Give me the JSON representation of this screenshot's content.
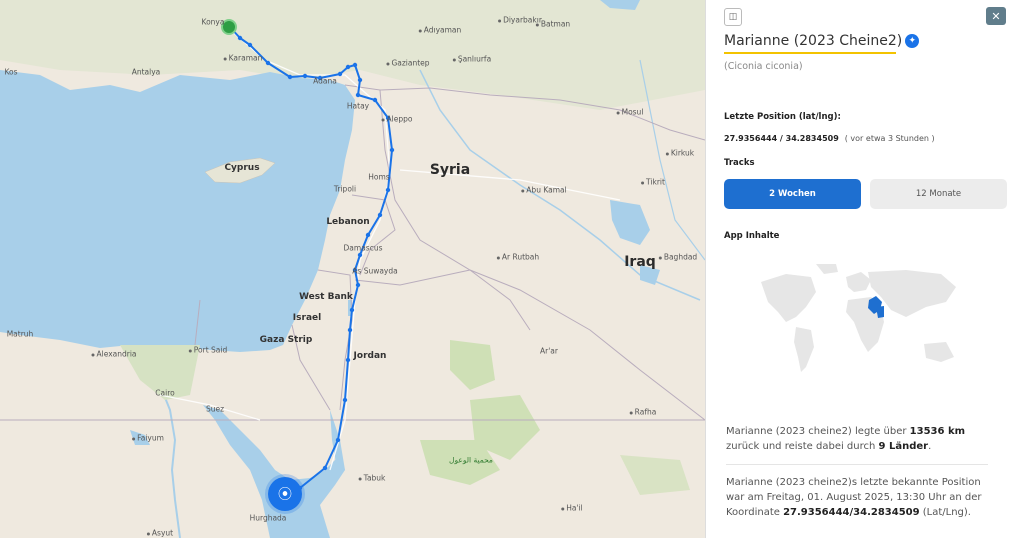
{
  "map": {
    "countries": [
      {
        "name": "Syria"
      },
      {
        "name": "Iraq"
      },
      {
        "name": "Cyprus"
      },
      {
        "name": "Lebanon"
      },
      {
        "name": "Israel"
      },
      {
        "name": "Jordan"
      },
      {
        "name": "West Bank"
      },
      {
        "name": "Gaza Strip"
      }
    ],
    "cities": [
      "Konya",
      "Karaman",
      "Antalya",
      "Adana",
      "Gaziantep",
      "Şanlıurfa",
      "Adıyaman",
      "Diyarbakır",
      "Batman",
      "Mosul",
      "Kirkuk",
      "Tikrit",
      "Hatay",
      "Aleppo",
      "Homs",
      "Tripoli",
      "Damascus",
      "As Suwayda",
      "Abu Kamal",
      "Ar Rutbah",
      "Baghdad",
      "Alexandria",
      "Port Said",
      "Cairo",
      "Suez",
      "Faiyum",
      "Tabuk",
      "Hurghada",
      "Asyut",
      "Matruh",
      "Ar'ar",
      "Rafha",
      "Ha'il",
      "Kos",
      "محمية الوعول"
    ],
    "track_color": "#1a73e8",
    "water_color": "#a8cfe9",
    "land_color": "#efeae2"
  },
  "panel": {
    "icon_button_label": "◫",
    "close_label": "✕",
    "title": "Marianne (2023 Cheine2)",
    "latin_name": "(Ciconia ciconia)",
    "last_position_label": "Letzte Position (lat/lng):",
    "coordinates": "27.9356444 / 34.2834509",
    "ago": "( vor etwa 3 Stunden )",
    "tracks_label": "Tracks",
    "tab_active": "2 Wochen",
    "tab_inactive": "12 Monate",
    "app_content_label": "App Inhalte",
    "desc1_a": "Marianne (2023 cheine2) legte über ",
    "desc1_km": "13536 km",
    "desc1_b": " zurück und reiste dabei durch ",
    "desc1_countries": "9 Länder",
    "desc1_c": ".",
    "desc2_a": "Marianne (2023 cheine2)s letzte bekannte Position war am Freitag, 01. August 2025, 13:30 Uhr an der Koordinate ",
    "desc2_coord": "27.9356444/34.2834509",
    "desc2_b": " (Lat/Lng).",
    "highlight_color": "#1e6fd0",
    "accent_underline": "#f3c300"
  }
}
